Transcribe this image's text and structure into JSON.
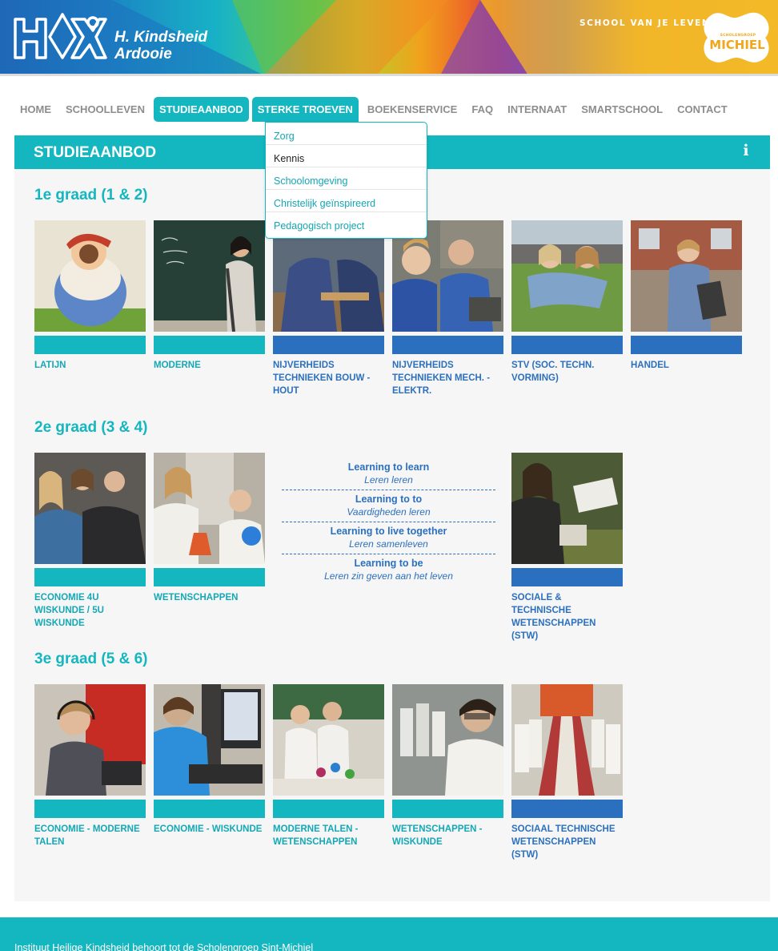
{
  "header": {
    "brand_line1": "H. Kindsheid",
    "brand_line2": "Ardooie",
    "slogan": "SCHOOL VAN JE LEVEN",
    "partner_small": "SCHOLENGROEP",
    "partner_name": "MICHIEL",
    "colors": {
      "teal": "#14b6bf",
      "blue": "#2b70bf"
    }
  },
  "nav": {
    "items": [
      {
        "label": "HOME"
      },
      {
        "label": "SCHOOLLEVEN"
      },
      {
        "label": "STUDIEAANBOD"
      },
      {
        "label": "STERKE TROEVEN"
      },
      {
        "label": "BOEKENSERVICE"
      },
      {
        "label": "FAQ"
      },
      {
        "label": "INTERNAAT"
      },
      {
        "label": "SMARTSCHOOL"
      },
      {
        "label": "CONTACT"
      }
    ],
    "active": "STUDIEAANBOD",
    "open": "STERKE TROEVEN"
  },
  "dropdown": {
    "items": [
      "Zorg",
      "Kennis",
      "Schoolomgeving",
      "Christelijk geïnspireerd",
      "Pedagogisch project"
    ],
    "hovered": "Kennis"
  },
  "panel": {
    "title": "STUDIEAANBOD",
    "info_icon": "info-icon"
  },
  "grades": [
    {
      "title": "1e graad (1 & 2)",
      "cards": [
        {
          "label": "LATIJN",
          "color": "teal"
        },
        {
          "label": "MODERNE",
          "color": "teal"
        },
        {
          "label": "NIJVERHEIDS TECHNIEKEN BOUW - HOUT",
          "color": "blue"
        },
        {
          "label": "NIJVERHEIDS TECHNIEKEN MECH. - ELEKTR.",
          "color": "blue"
        },
        {
          "label": "STV (SOC. TECHN. VORMING)",
          "color": "blue"
        },
        {
          "label": "HANDEL",
          "color": "blue"
        }
      ]
    },
    {
      "title": "2e graad (3 & 4)",
      "cards": [
        {
          "label": "ECONOMIE 4U WISKUNDE / 5U WISKUNDE",
          "color": "teal"
        },
        {
          "label": "WETENSCHAPPEN",
          "color": "teal"
        },
        {
          "label": "SOCIALE & TECHNISCHE WETENSCHAPPEN (STW)",
          "color": "blue"
        }
      ],
      "learning": [
        {
          "en": "Learning to learn",
          "nl": "Leren leren"
        },
        {
          "en": "Learning to to",
          "nl": "Vaardigheden leren"
        },
        {
          "en": "Learning to live together",
          "nl": "Leren samenleven"
        },
        {
          "en": "Learning to be",
          "nl": "Leren zin geven aan het leven"
        }
      ]
    },
    {
      "title": "3e graad (5 & 6)",
      "cards": [
        {
          "label": "ECONOMIE - MODERNE TALEN",
          "color": "teal"
        },
        {
          "label": "ECONOMIE - WISKUNDE",
          "color": "teal"
        },
        {
          "label": "MODERNE TALEN - WETENSCHAPPEN",
          "color": "teal"
        },
        {
          "label": "WETENSCHAPPEN - WISKUNDE",
          "color": "teal"
        },
        {
          "label": "SOCIAAL TECHNISCHE WETENSCHAPPEN (STW)",
          "color": "blue"
        }
      ]
    }
  ],
  "footer": {
    "text": "Instituut Heilige Kindsheid behoort tot de Scholengroep Sint-Michiel"
  }
}
